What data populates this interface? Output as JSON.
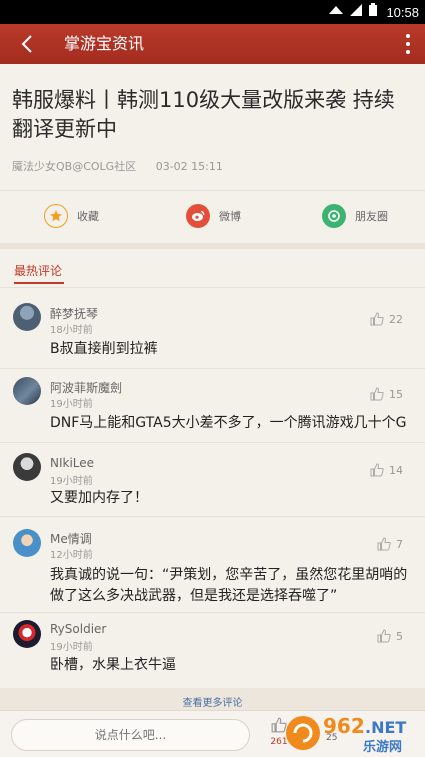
{
  "status_bar": {
    "time": "10:58"
  },
  "header": {
    "title": "掌游宝资讯"
  },
  "article": {
    "title": "韩服爆料丨韩测110级大量改版来袭 持续翻译更新中",
    "author": "魇法少女QB@COLG社区",
    "date": "03-02 15:11"
  },
  "share": [
    {
      "label": "收藏",
      "icon": "star-icon",
      "color": "#f0a020"
    },
    {
      "label": "微博",
      "icon": "weibo-icon",
      "color": "#e2503a"
    },
    {
      "label": "朋友圈",
      "icon": "moments-icon",
      "color": "#3cb371"
    }
  ],
  "comments_section": {
    "heading": "最热评论",
    "items": [
      {
        "user": "醉梦抚琴",
        "time": "18小时前",
        "text": "B叔直接削到拉裤",
        "likes": "22"
      },
      {
        "user": "阿波菲斯魔劍",
        "time": "19小时前",
        "text": "DNF马上能和GTA5大小差不多了，一个腾讯游戏几十个G",
        "likes": "15"
      },
      {
        "user": "NIkiLee",
        "time": "19小时前",
        "text": "又要加内存了！",
        "likes": "14"
      },
      {
        "user": "Me情调",
        "time": "12小时前",
        "text": "我真诚的说一句：“尹策划，您辛苦了，虽然您花里胡哨的做了这么多决战武器，但是我还是选择吞噬了”",
        "likes": "7"
      },
      {
        "user": "RySoldier",
        "time": "19小时前",
        "text": "卧槽，水果上衣牛逼",
        "likes": "5"
      }
    ],
    "see_more": "查看更多评论"
  },
  "bottom_bar": {
    "input_placeholder": "说点什么吧...",
    "like_count": "261",
    "comment_count": "25"
  },
  "watermark": {
    "text": "962.NET",
    "subtext": "乐游网"
  },
  "colors": {
    "header": "#a8301f",
    "accent": "#c0392b",
    "background": "#f4f0ea"
  }
}
